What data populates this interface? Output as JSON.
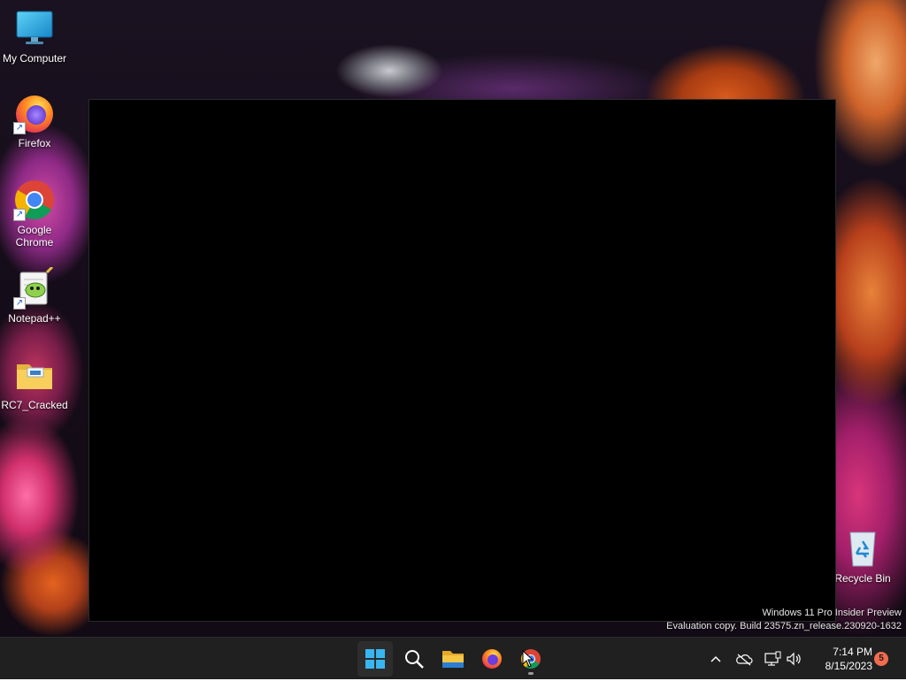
{
  "desktop": {
    "icons": [
      {
        "label": "My Computer",
        "icon": "monitor-icon"
      },
      {
        "label": "Firefox",
        "icon": "firefox-icon"
      },
      {
        "label": "Google Chrome",
        "icon": "chrome-icon"
      },
      {
        "label": "Notepad++",
        "icon": "notepadpp-icon"
      },
      {
        "label": "RC7_Cracked",
        "icon": "folder-icon"
      },
      {
        "label": "Recycle Bin",
        "icon": "recycle-bin-icon"
      }
    ],
    "watermark": {
      "line1": "Windows 11 Pro Insider Preview",
      "line2": "Evaluation copy. Build 23575.zn_release.230920-1632"
    }
  },
  "taskbar": {
    "apps": [
      {
        "name": "Start",
        "icon": "windows-start-icon"
      },
      {
        "name": "Search",
        "icon": "search-icon"
      },
      {
        "name": "File Explorer",
        "icon": "file-explorer-icon"
      },
      {
        "name": "Firefox",
        "icon": "firefox-icon"
      },
      {
        "name": "Google Chrome",
        "icon": "chrome-icon",
        "running": true
      }
    ],
    "tray": {
      "icons": [
        "chevron-up-icon",
        "onedrive-offline-icon",
        "network-icon",
        "volume-icon"
      ],
      "time": "7:14 PM",
      "date": "8/15/2023",
      "notification_count": "5"
    }
  },
  "colors": {
    "taskbar_bg": "#202020",
    "window_bg": "#000000",
    "notification_badge": "#f26b4f"
  }
}
